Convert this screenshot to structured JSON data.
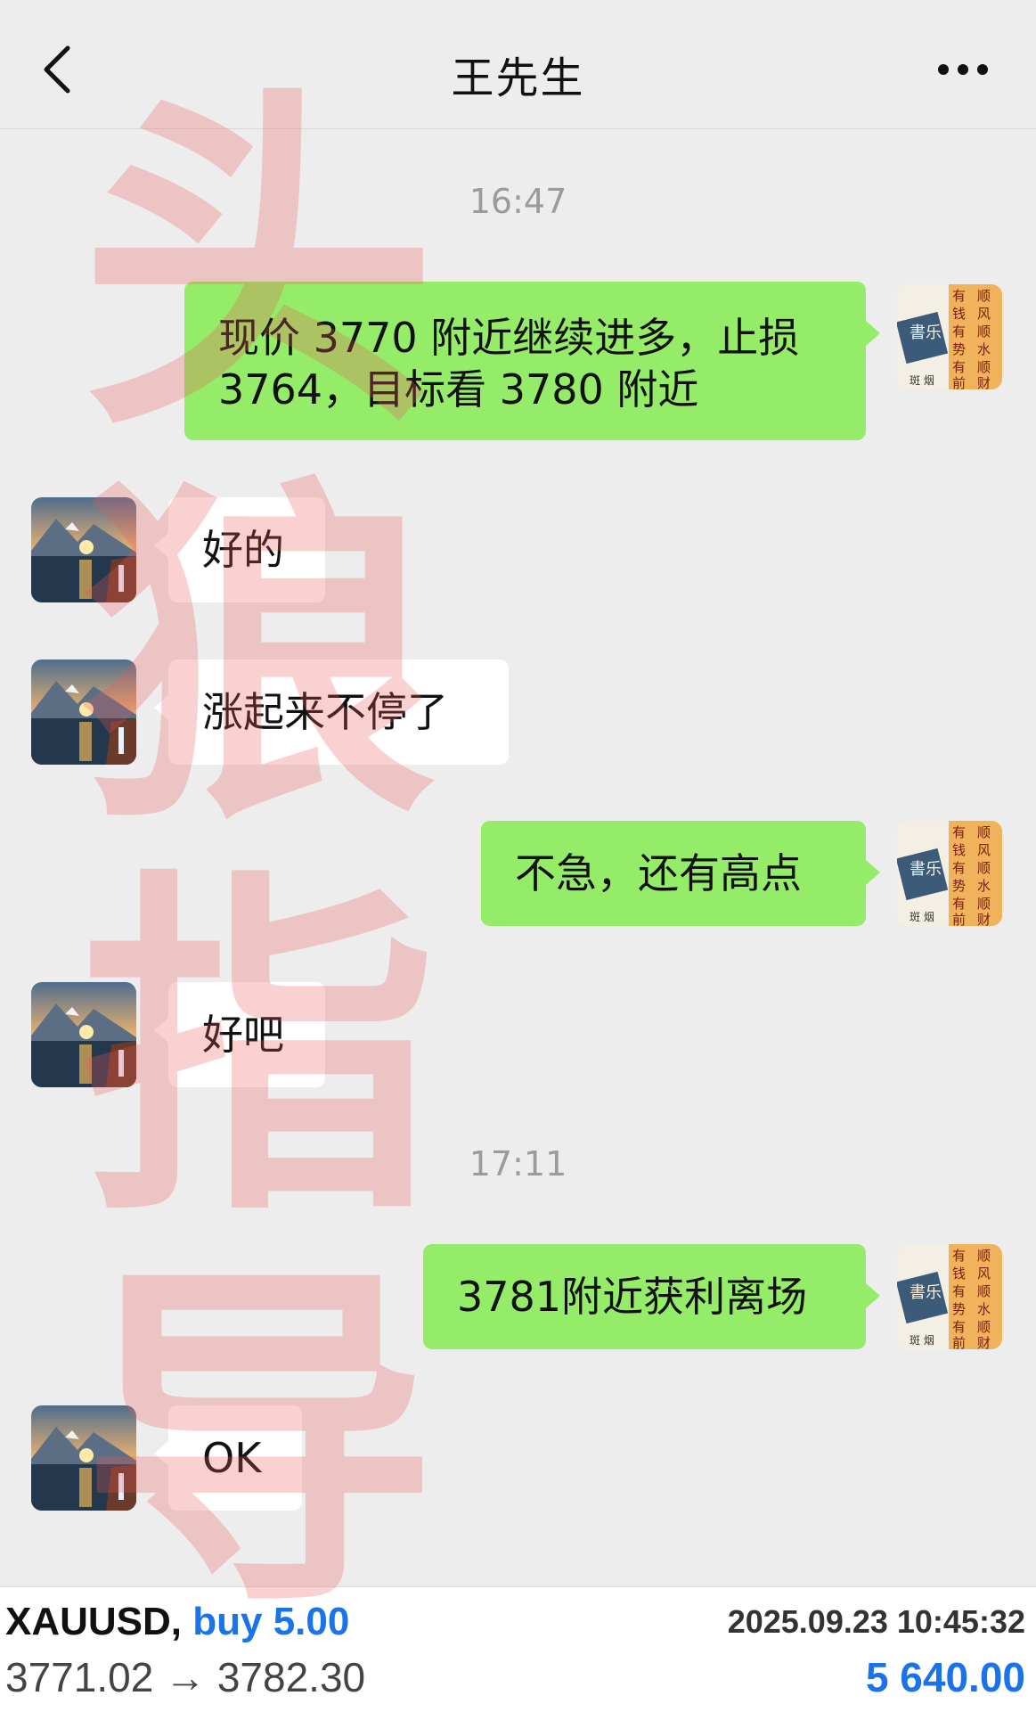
{
  "header": {
    "title": "王先生"
  },
  "messages": [
    {
      "type": "time",
      "text": "16:47"
    },
    {
      "type": "out",
      "lines": [
        "现价 3770 附近继续进多，止损",
        "3764，目标看 3780 附近"
      ]
    },
    {
      "type": "in",
      "text": "好的"
    },
    {
      "type": "in",
      "text": "涨起来不停了"
    },
    {
      "type": "out",
      "text": "不急，还有高点"
    },
    {
      "type": "in",
      "text": "好吧"
    },
    {
      "type": "time",
      "text": "17:11"
    },
    {
      "type": "out",
      "text": "3781附近获利离场"
    },
    {
      "type": "in",
      "text": "OK"
    }
  ],
  "self_avatar": {
    "icon": "calligraphy-avatar",
    "seal_text": "書乐",
    "small_text": "斑 烟",
    "calligraphy": "有钱有势有前 顺风顺水顺财"
  },
  "contact_avatar": {
    "icon": "mountain-lake-sunset-avatar"
  },
  "watermark": {
    "chars": [
      "头",
      "狼",
      "指",
      "导"
    ]
  },
  "trade": {
    "symbol": "XAUUSD,",
    "side": "buy 5.00",
    "time": "2025.09.23 10:45:32",
    "prices": "3771.02 → 3782.30",
    "profit": "5 640.00"
  },
  "colors": {
    "background": "#ededed",
    "outgoing_bubble": "#95ec69",
    "incoming_bubble": "#ffffff",
    "accent_blue": "#1a73e8",
    "watermark_red": "#eb5a5a"
  }
}
